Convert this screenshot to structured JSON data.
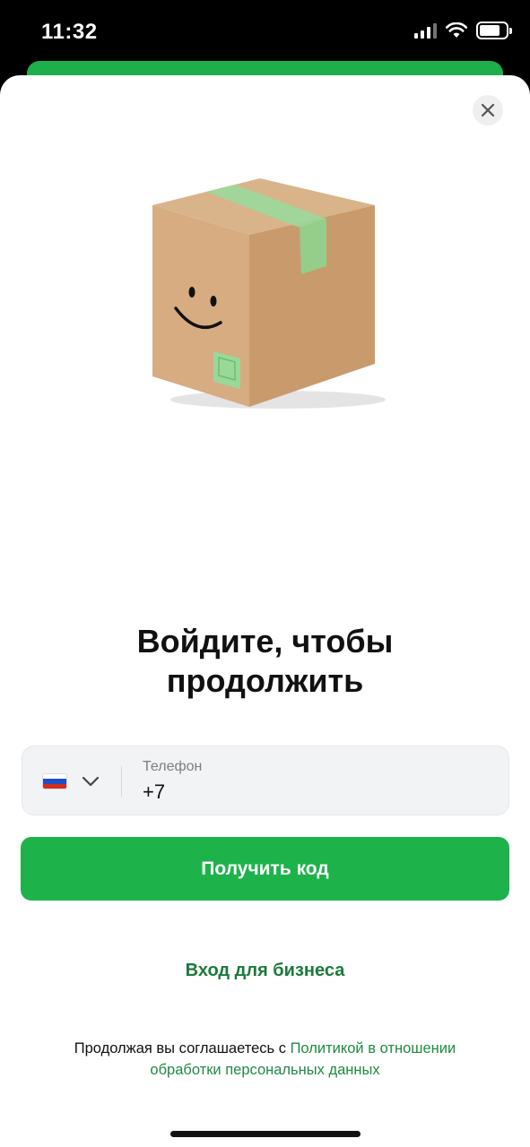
{
  "status_bar": {
    "time": "11:32",
    "icons": [
      "signal-icon",
      "wifi-icon",
      "battery-icon"
    ]
  },
  "sheet": {
    "close_icon": "close-icon",
    "illustration": "smiling-cardboard-box",
    "title_line1": "Войдите, чтобы",
    "title_line2": "продолжить",
    "phone": {
      "country_flag": "russia-flag-icon",
      "label": "Телефон",
      "value": "+7"
    },
    "get_code_button": "Получить код",
    "business_login": "Вход для бизнеса",
    "consent_text": "Продолжая вы соглашаетесь с ",
    "consent_link_line1": "Политикой в отношении",
    "consent_link_line2": "обработки персональных данных"
  },
  "colors": {
    "accent_green": "#1db34a",
    "link_green": "#1d7a3a"
  }
}
